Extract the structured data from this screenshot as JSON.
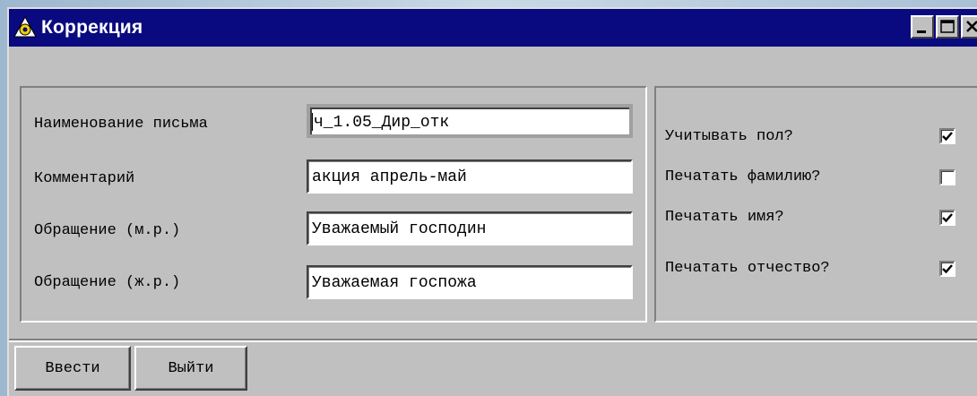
{
  "window": {
    "title": "Коррекция"
  },
  "form": {
    "fields": [
      {
        "label": "Наименование письма",
        "value": "ч_1.05_Дир_отк"
      },
      {
        "label": "Комментарий",
        "value": "акция апрель-май"
      },
      {
        "label": "Обращение (м.р.)",
        "value": "Уважаемый господин"
      },
      {
        "label": "Обращение (ж.р.)",
        "value": "Уважаемая госпожа"
      }
    ],
    "options": [
      {
        "label": "Учитывать пол?",
        "checked": true
      },
      {
        "label": "Печатать фамилию?",
        "checked": false
      },
      {
        "label": "Печатать имя?",
        "checked": true
      },
      {
        "label": "Печатать отчество?",
        "checked": true
      }
    ]
  },
  "buttons": {
    "enter": "Ввести",
    "exit": "Выйти"
  },
  "colors": {
    "titlebar": "#0a0a80",
    "face": "#c0c0c0"
  },
  "icons": {
    "app": "app-icon",
    "minimize": "minimize-icon",
    "maximize": "maximize-icon",
    "close": "close-icon",
    "check": "checkmark-icon"
  }
}
